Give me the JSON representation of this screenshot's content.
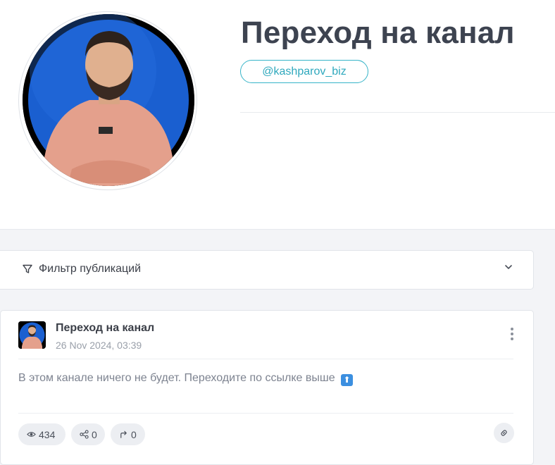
{
  "channel": {
    "title": "Переход на канал",
    "username": "@kashparov_biz"
  },
  "filter": {
    "label": "Фильтр публикаций"
  },
  "post": {
    "author": "Переход на канал",
    "date": "26 Nov 2024, 03:39",
    "text": "В этом канале ничего не будет. Переходите по ссылке выше",
    "emoji": "⬆",
    "stats": {
      "views": "434",
      "shares": "0",
      "forwards": "0"
    }
  },
  "colors": {
    "accent": "#2ea8bd",
    "title": "#3d4350",
    "avatar_bg": "#1a5fd0"
  }
}
